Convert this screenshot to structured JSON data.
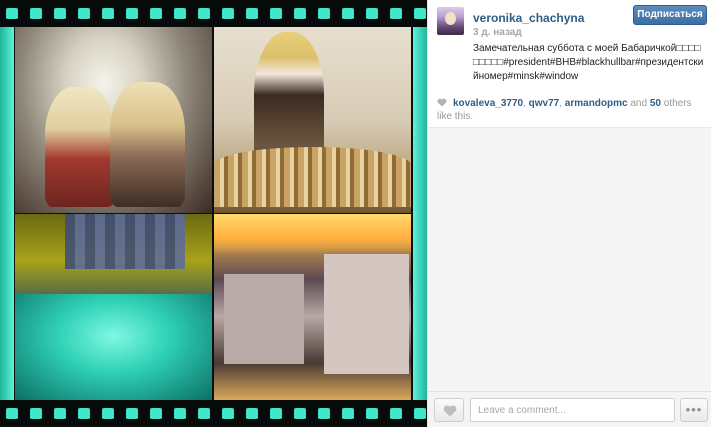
{
  "post": {
    "username": "veronika_chachyna",
    "time_ago": "3 д. назад",
    "caption": "Замечательная суббота с моей Бабаричкой□□□□□□□□□#president#BHB#blackhullbar#президентскийномер#minsk#window",
    "follow_label": "Подписаться"
  },
  "likes": {
    "likers": [
      "kovaleva_3770",
      "qwv77",
      "armandopmc"
    ],
    "separator": ", ",
    "and_text": " and ",
    "others_count": "50",
    "others_suffix": " others like this."
  },
  "comment_box": {
    "placeholder": "Leave a comment..."
  },
  "more_button": {
    "label": "•••"
  },
  "icons": {
    "like": "heart-icon",
    "likes_summary": "heart-icon",
    "more": "ellipsis-icon"
  },
  "colors": {
    "link": "#2e5e86",
    "follow_button": "#4a7db2",
    "film_accent": "#3fe6c7"
  }
}
